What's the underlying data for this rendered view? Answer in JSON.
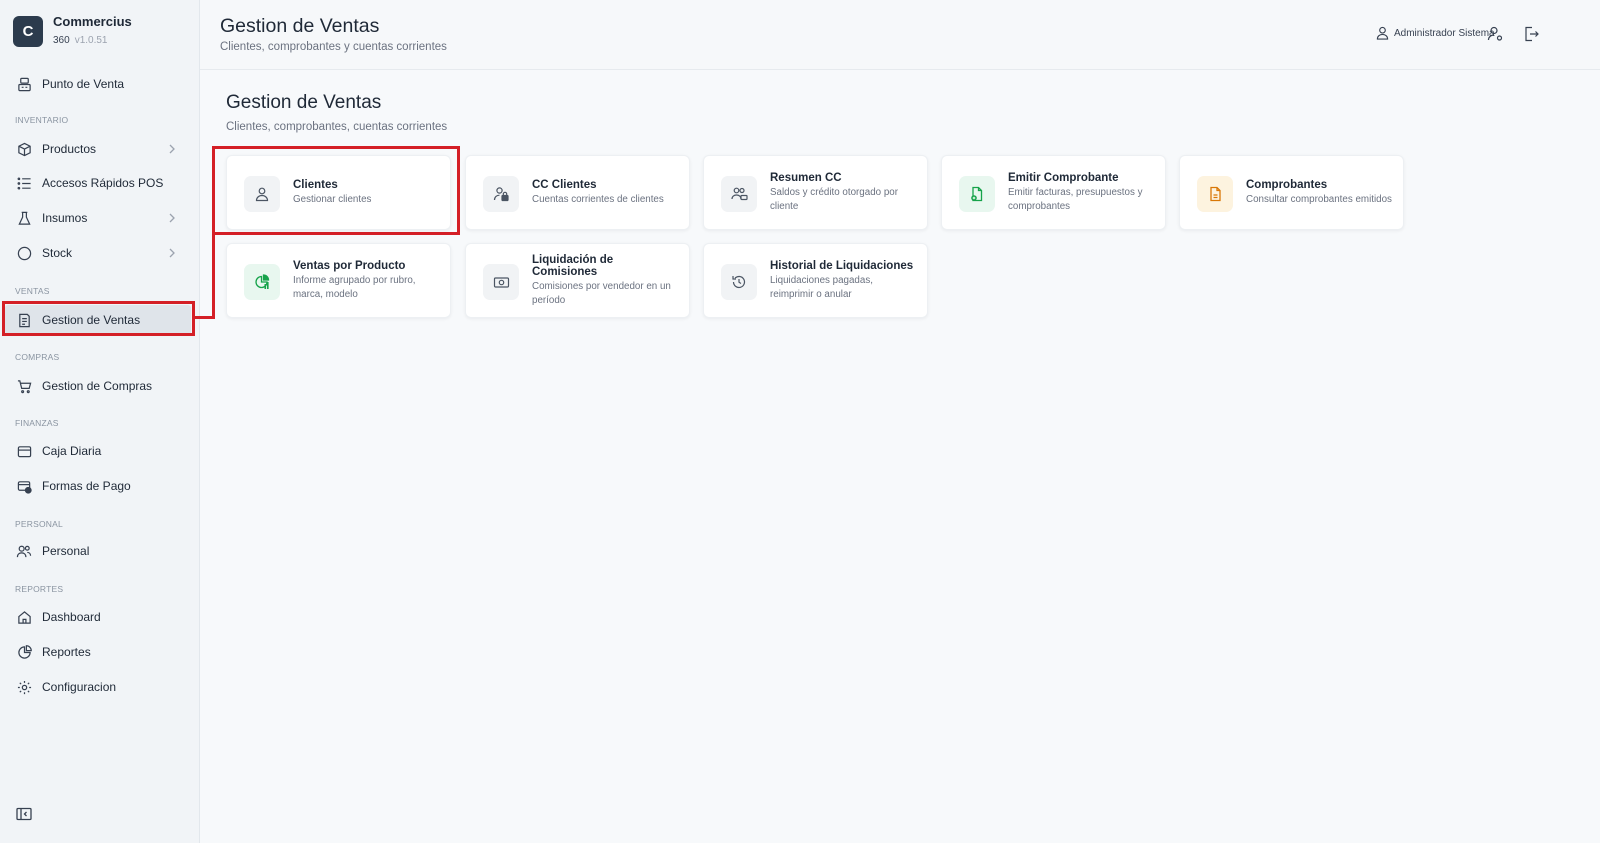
{
  "brand": {
    "logo_letter": "C",
    "name": "Commercius",
    "sub": "360",
    "version": "v1.0.51"
  },
  "sidebar": {
    "top_item": {
      "label": "Punto de Venta"
    },
    "sections": {
      "inventario": "INVENTARIO",
      "ventas": "VENTAS",
      "compras": "COMPRAS",
      "finanzas": "FINANZAS",
      "personal": "PERSONAL",
      "reportes": "REPORTES"
    },
    "items": {
      "productos": "Productos",
      "accesos": "Accesos Rápidos POS",
      "insumos": "Insumos",
      "stock": "Stock",
      "gestion_ventas": "Gestion de Ventas",
      "gestion_compras": "Gestion de Compras",
      "caja": "Caja Diaria",
      "formas_pago": "Formas de Pago",
      "personal": "Personal",
      "dashboard": "Dashboard",
      "reportes": "Reportes",
      "configuracion": "Configuracion"
    },
    "active_item": "Gestion de Ventas"
  },
  "header": {
    "title": "Gestion de Ventas",
    "subtitle": "Clientes, comprobantes y cuentas corrientes",
    "user": "Administrador Sistema"
  },
  "main": {
    "title": "Gestion de Ventas",
    "subtitle": "Clientes, comprobantes, cuentas corrientes",
    "cards": [
      {
        "title": "Clientes",
        "desc": "Gestionar clientes",
        "icon": "user-icon"
      },
      {
        "title": "CC Clientes",
        "desc": "Cuentas corrientes de clientes",
        "icon": "user-lock-icon"
      },
      {
        "title": "Resumen CC",
        "desc": "Saldos y crédito otorgado por cliente",
        "icon": "users-money-icon"
      },
      {
        "title": "Emitir Comprobante",
        "desc": "Emitir facturas, presupuestos y comprobantes",
        "icon": "file-plus-icon"
      },
      {
        "title": "Comprobantes",
        "desc": "Consultar comprobantes emitidos",
        "icon": "file-icon"
      },
      {
        "title": "Ventas por Producto",
        "desc": "Informe agrupado por rubro, marca, modelo",
        "icon": "chart-pie-icon"
      },
      {
        "title": "Liquidación de Comisiones",
        "desc": "Comisiones por vendedor en un período",
        "icon": "banknote-icon"
      },
      {
        "title": "Historial de Liquidaciones",
        "desc": "Liquidaciones pagadas, reimprimir o anular",
        "icon": "history-icon"
      }
    ]
  },
  "colors": {
    "highlight": "#d41f26",
    "brand": "#2c3b4d",
    "green": "#16a34a",
    "amber": "#d97706"
  }
}
